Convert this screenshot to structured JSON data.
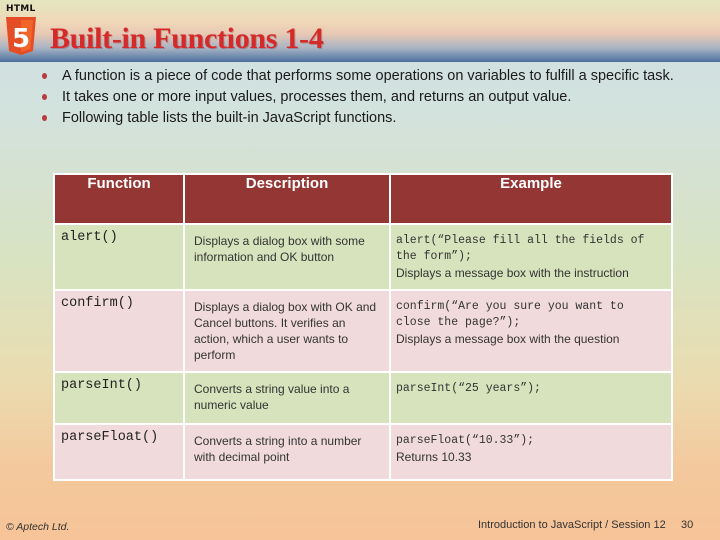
{
  "header": {
    "badge_text": "HTML",
    "logo_digit": "5",
    "title": "Built-in Functions 1-4"
  },
  "bullets": [
    "A function is a piece of code that performs some operations on variables to fulfill a specific task.",
    "It takes one or more input values, processes them, and returns an output value.",
    "Following table lists the built-in JavaScript functions."
  ],
  "table": {
    "headers": [
      "Function",
      "Description",
      "Example"
    ],
    "rows": [
      {
        "function": "alert()",
        "description": "Displays a dialog box with some information and OK button",
        "example_code": "alert(“Please fill all the fields of the form”);",
        "example_note": "Displays a message box with the instruction"
      },
      {
        "function": "confirm()",
        "description": "Displays a dialog box with OK and Cancel buttons. It verifies an action, which a user wants to perform",
        "example_code": "confirm(“Are you sure you want to close the page?”);",
        "example_note": "Displays a message box with the question"
      },
      {
        "function": "parseInt()",
        "description": "Converts a string value into a numeric value",
        "example_code": "parseInt(“25 years”);",
        "example_note": ""
      },
      {
        "function": "parseFloat()",
        "description": "Converts a string into a number with decimal point",
        "example_code": "parseFloat(“10.33”);",
        "example_note": "Returns 10.33"
      }
    ]
  },
  "footer": {
    "copyright": "© Aptech Ltd.",
    "course": "Introduction to JavaScript / Session 12",
    "page_number": "30"
  },
  "colors": {
    "title": "#d42a2a",
    "table_header": "#943634",
    "row_green": "#d7e3bc",
    "row_pink": "#f1dadb"
  }
}
